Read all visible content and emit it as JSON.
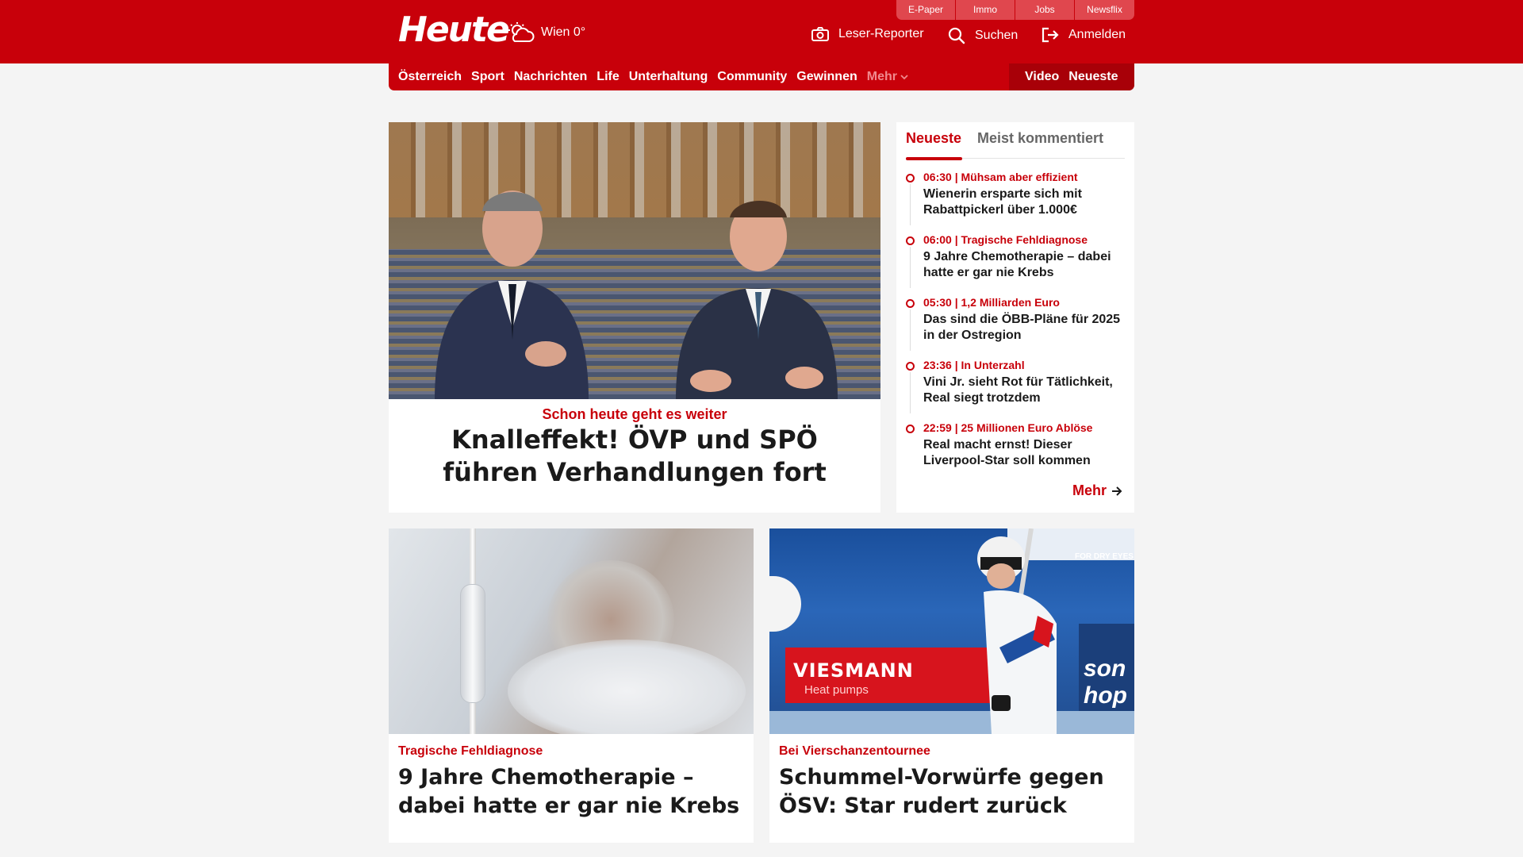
{
  "colors": {
    "brand_red": "#c8000a",
    "dark_red": "#a80008",
    "service_red": "#e0474e",
    "page_bg": "#f4f4f4"
  },
  "header": {
    "logo": "Heute",
    "weather": {
      "icon": "cloud-sun-icon",
      "text": "Wien 0°"
    },
    "services": [
      "E-Paper",
      "Immo",
      "Jobs",
      "Newsflix"
    ],
    "actions": {
      "reporter": {
        "icon": "camera-icon",
        "label": "Leser-Reporter"
      },
      "search": {
        "icon": "search-icon",
        "label": "Suchen"
      },
      "login": {
        "icon": "login-icon",
        "label": "Anmelden"
      }
    }
  },
  "nav": {
    "items": [
      "Österreich",
      "Sport",
      "Nachrichten",
      "Life",
      "Unterhaltung",
      "Community",
      "Gewinnen"
    ],
    "more": "Mehr",
    "right": [
      "Video",
      "Neueste"
    ]
  },
  "hero": {
    "kicker": "Schon heute geht es weiter",
    "title": "Knalleffekt! ÖVP und SPÖ führen Verhandlungen fort"
  },
  "sidebar": {
    "tabs": [
      "Neueste",
      "Meist kommentiert"
    ],
    "items": [
      {
        "meta": "06:30 | Mühsam aber effizient",
        "title": "Wienerin ersparte sich mit Rabattpickerl über 1.000€"
      },
      {
        "meta": "06:00 | Tragische Fehldiagnose",
        "title": "9 Jahre Chemotherapie – dabei hatte er gar nie Krebs"
      },
      {
        "meta": "05:30 | 1,2 Milliarden Euro",
        "title": "Das sind die ÖBB-Pläne für 2025 in der Ostregion"
      },
      {
        "meta": "23:36 | In Unterzahl",
        "title": "Vini Jr. sieht Rot für Tätlichkeit, Real siegt trotzdem"
      },
      {
        "meta": "22:59 | 25 Millionen Euro Ablöse",
        "title": "Real macht ernst! Dieser Liverpool-Star soll kommen"
      }
    ],
    "more": "Mehr"
  },
  "cards": [
    {
      "kicker": "Tragische Fehldiagnose",
      "title": "9 Jahre Chemotherapie – dabei hatte er gar nie Krebs"
    },
    {
      "kicker": "Bei Vierschanzentournee",
      "title": "Schummel-Vorwürfe gegen ÖSV: Star rudert zurück"
    }
  ],
  "image_text": {
    "ski_banner": "VIESMANN",
    "ski_banner_sub": "Heat pumps",
    "ski_right": "son\nhop",
    "ski_top": "FOR DRY EYES"
  }
}
